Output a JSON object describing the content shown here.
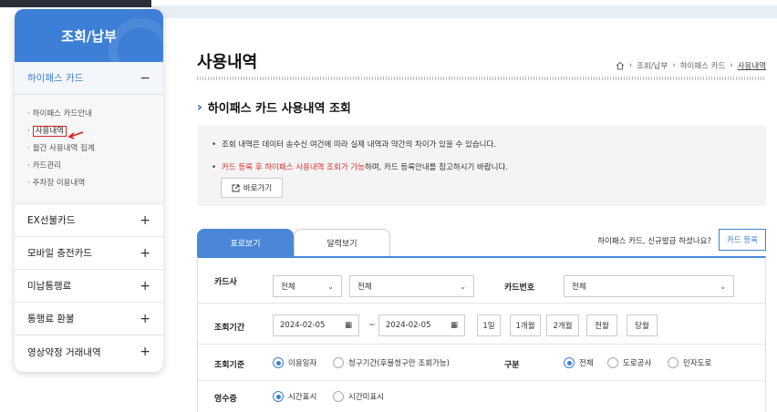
{
  "sidebar": {
    "title": "조회/납부",
    "sections": [
      {
        "label": "하이패스 카드",
        "sign": "−"
      },
      {
        "label": "EX선불카드",
        "sign": "+"
      },
      {
        "label": "모바일 충전카드",
        "sign": "+"
      },
      {
        "label": "미납통행료",
        "sign": "+"
      },
      {
        "label": "통행료 환불",
        "sign": "+"
      },
      {
        "label": "영상약정 거래내역",
        "sign": "+"
      }
    ],
    "sub_items": [
      "하이패스 카드안내",
      "사용내역",
      "월간 사용내역 집계",
      "카드관리",
      "주차장 이용내역"
    ]
  },
  "page": {
    "title": "사용내역",
    "breadcrumb": [
      "조회/납부",
      "하이패스 카드",
      "사용내역"
    ]
  },
  "section_title": "하이패스 카드 사용내역 조회",
  "notice": {
    "line1": "조회 내역은 데이터 송수신 여건에 따라 실제 내역과 약간의 차이가 있을 수 있습니다.",
    "line2_red": "카드 등록 후 하이패스 사용내역 조회가 가능",
    "line2_rest": "하며, 카드 등록안내를 참고하시기 바랍니다.",
    "goto_label": "바로가기"
  },
  "tabs": [
    "표로보기",
    "달력보기"
  ],
  "card_question": "하이패스 카드, 신규발급 하셨나요?",
  "card_register": "카드 등록",
  "form": {
    "card_type_label": "카드사",
    "card_type_value1": "전체",
    "card_type_value2": "전체",
    "card_number_label": "카드번호",
    "card_number_value": "전체",
    "period_label": "조회기간",
    "date_from": "2024-02-05",
    "date_to": "2024-02-05",
    "tilde": "~",
    "period_buttons": [
      "1일",
      "1개월",
      "2개월",
      "전월",
      "당월"
    ],
    "basis_label": "조회기준",
    "basis_options": [
      "이용일자",
      "청구기간(후불청구만 조회가능)"
    ],
    "category_label": "구분",
    "category_options": [
      "전체",
      "도로공사",
      "민자도로"
    ],
    "receipt_label": "영수증",
    "receipt_options": [
      "시간표시",
      "시간미표시"
    ]
  }
}
